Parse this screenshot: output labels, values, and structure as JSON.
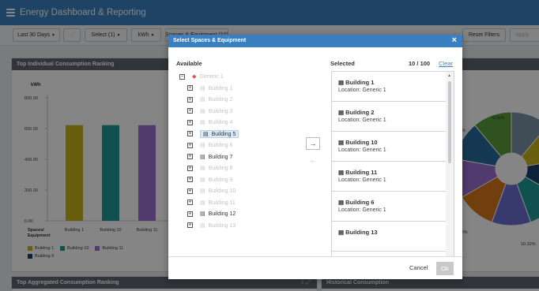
{
  "app": {
    "title": "Energy Dashboard & Reporting"
  },
  "toolbar": {
    "period": "Last 30 Days",
    "select": "Select (1)",
    "unit": "kWh",
    "spaces": "Spaces & Equipment (10)",
    "reset": "Reset Filters",
    "apply": "Apply"
  },
  "panels": {
    "top_individual": "Top Individual Consumption Ranking",
    "top_aggregated": "Top Aggregated Consumption Ranking",
    "historical": "Historical Consumption"
  },
  "chart_data": {
    "type": "bar",
    "ylabel": "kWh",
    "ylim": [
      0,
      800
    ],
    "yticks": [
      "0.00",
      "200.00",
      "400.00",
      "600.00",
      "800.00"
    ],
    "xlabel": "Spaces/ Equipment",
    "categories": [
      "Building 1",
      "Building 10",
      "Building 11"
    ],
    "values": [
      622,
      622,
      622
    ],
    "colors": [
      "#c9b21c",
      "#1f9b9a",
      "#9b6fd2"
    ]
  },
  "legend": [
    {
      "label": "Building 1",
      "color": "#c9b21c"
    },
    {
      "label": "Building 10",
      "color": "#1f9b9a"
    },
    {
      "label": "Building 11",
      "color": "#9b6fd2"
    },
    {
      "label": "Building 9",
      "color": "#1d3f6e"
    }
  ],
  "pie": {
    "labels": [
      "5.56%",
      "3%",
      ".32%",
      "10.32%"
    ],
    "colors": [
      "#7e95a6",
      "#c9b21c",
      "#1d3f6e",
      "#1f9b9a",
      "#6b6fd2",
      "#d97a1c",
      "#9b6fd2",
      "#2a6e9e",
      "#5a9e3c"
    ]
  },
  "modal": {
    "title": "Select Spaces & Equipment",
    "close": "×",
    "available_title": "Available",
    "selected_title": "Selected",
    "count": "10 / 100",
    "clear": "Clear",
    "cancel": "Cancel",
    "ok": "Ok",
    "move_right": "→",
    "move_left": "←"
  },
  "tree": {
    "root": {
      "expander": "−",
      "label": "Generic 1"
    },
    "items": [
      {
        "expander": "+",
        "label": "Building 1",
        "state": "dim"
      },
      {
        "expander": "+",
        "label": "Building 2",
        "state": "dim"
      },
      {
        "expander": "+",
        "label": "Building 3",
        "state": "dim"
      },
      {
        "expander": "+",
        "label": "Building 4",
        "state": "dim"
      },
      {
        "expander": "+",
        "label": "Building 5",
        "state": "highlight"
      },
      {
        "expander": "+",
        "label": "Building 6",
        "state": "dim"
      },
      {
        "expander": "+",
        "label": "Building 7",
        "state": "strong"
      },
      {
        "expander": "+",
        "label": "Building 8",
        "state": "dim"
      },
      {
        "expander": "+",
        "label": "Building 9",
        "state": "dim"
      },
      {
        "expander": "+",
        "label": "Building 10",
        "state": "dim"
      },
      {
        "expander": "+",
        "label": "Building 11",
        "state": "dim"
      },
      {
        "expander": "+",
        "label": "Building 12",
        "state": "strong"
      },
      {
        "expander": "+",
        "label": "Building 13",
        "state": "dim"
      }
    ]
  },
  "selected": [
    {
      "name": "Building 1",
      "location": "Location: Generic 1"
    },
    {
      "name": "Building 2",
      "location": "Location: Generic 1"
    },
    {
      "name": "Building 10",
      "location": "Location: Generic 1"
    },
    {
      "name": "Building 11",
      "location": "Location: Generic 1"
    },
    {
      "name": "Building 6",
      "location": "Location: Generic 1"
    },
    {
      "name": "Building 13",
      "location": ""
    }
  ]
}
